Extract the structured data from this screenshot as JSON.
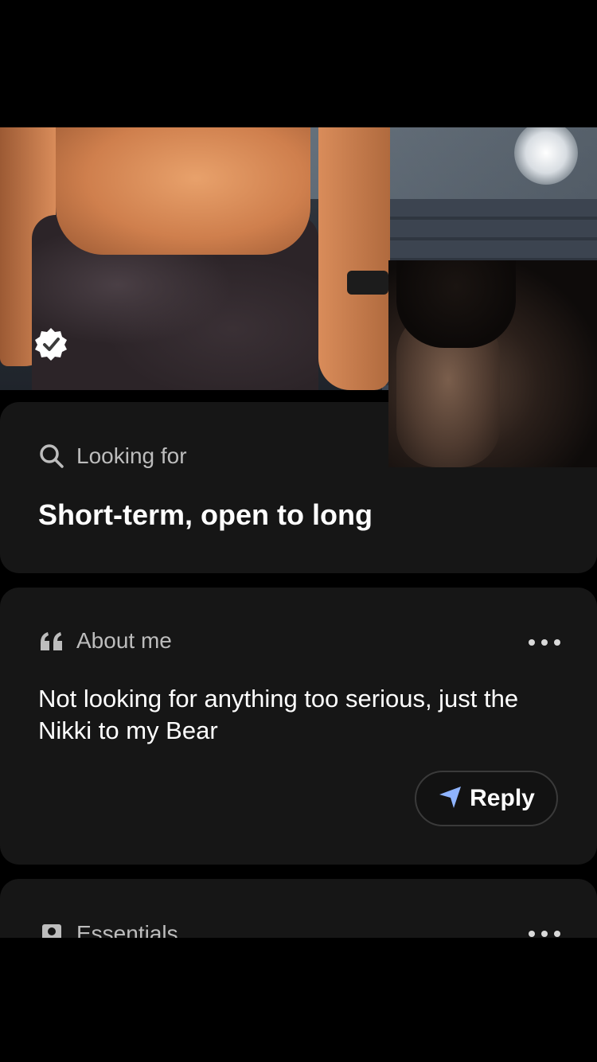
{
  "profile": {
    "photo_description_icon": "verified-badge-icon",
    "verified": true
  },
  "looking_for": {
    "icon": "search-icon",
    "label": "Looking for",
    "value": "Short-term, open to long"
  },
  "about_me": {
    "icon": "quote-icon",
    "label": "About me",
    "text": "Not looking for anything too serious, just the Nikki to my Bear",
    "more_icon": "more-horizontal-icon",
    "reply_icon": "send-icon",
    "reply_label": "Reply"
  },
  "essentials": {
    "icon": "profile-card-icon",
    "label": "Essentials",
    "more_icon": "more-horizontal-icon"
  },
  "colors": {
    "background": "#000000",
    "card": "#161616",
    "muted_text": "#bdbdbd",
    "reply_accent": "#8fb4ff"
  }
}
